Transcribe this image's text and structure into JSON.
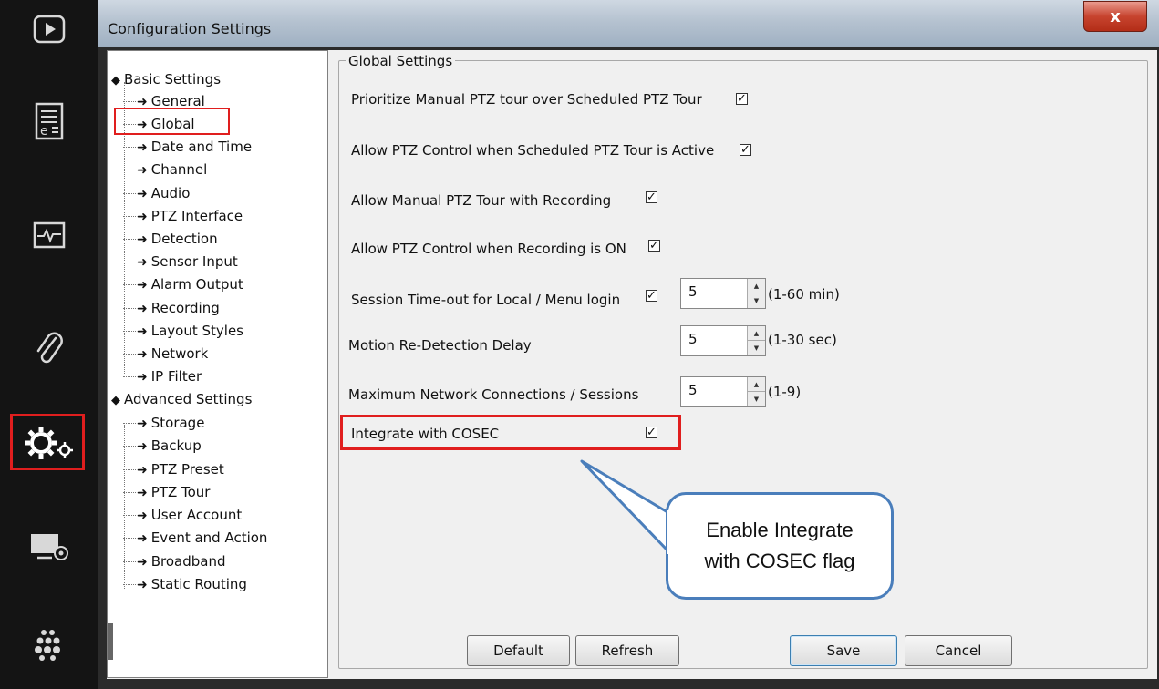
{
  "sidebar": {
    "icons": [
      "play-icon",
      "event-log-icon",
      "monitor-health-icon",
      "attachment-icon",
      "settings-icon",
      "display-settings-icon",
      "apps-grid-icon"
    ]
  },
  "window": {
    "title": "Configuration Settings",
    "close_glyph": "x"
  },
  "tree": {
    "root_basic": "Basic Settings",
    "basic_items": [
      "General",
      "Global",
      "Date and Time",
      "Channel",
      "Audio",
      "PTZ Interface",
      "Detection",
      "Sensor Input",
      "Alarm Output",
      "Recording",
      "Layout Styles",
      "Network",
      "IP Filter"
    ],
    "root_advanced": "Advanced Settings",
    "advanced_items": [
      "Storage",
      "Backup",
      "PTZ Preset",
      "PTZ Tour",
      "User Account",
      "Event and Action",
      "Broadband",
      "Static Routing"
    ],
    "selected": "Global"
  },
  "global": {
    "group_title": "Global Settings",
    "prioritize_manual": {
      "label": "Prioritize Manual PTZ tour over Scheduled PTZ Tour",
      "checked": true
    },
    "allow_ptz_sched": {
      "label": "Allow PTZ Control when Scheduled PTZ Tour is Active",
      "checked": true
    },
    "allow_manual_rec": {
      "label": "Allow Manual PTZ Tour with Recording",
      "checked": true
    },
    "allow_ptz_rec": {
      "label": "Allow PTZ Control when Recording is ON",
      "checked": true
    },
    "session_timeout": {
      "label": "Session Time-out for Local / Menu login",
      "checked": true,
      "value": "5",
      "range": "(1-60 min)"
    },
    "motion_delay": {
      "label": "Motion Re-Detection Delay",
      "value": "5",
      "range": "(1-30 sec)"
    },
    "max_connections": {
      "label": "Maximum Network Connections / Sessions",
      "value": "5",
      "range": "(1-9)"
    },
    "integrate_cosec": {
      "label": "Integrate with COSEC",
      "checked": true
    },
    "check_glyph": "✓"
  },
  "callout": {
    "line1": "Enable Integrate",
    "line2": "with COSEC flag"
  },
  "buttons": {
    "default": "Default",
    "refresh": "Refresh",
    "save": "Save",
    "cancel": "Cancel"
  },
  "colors": {
    "highlight": "#e01e1e",
    "callout_border": "#4a7ebb",
    "sidebar_bg": "#141414"
  }
}
